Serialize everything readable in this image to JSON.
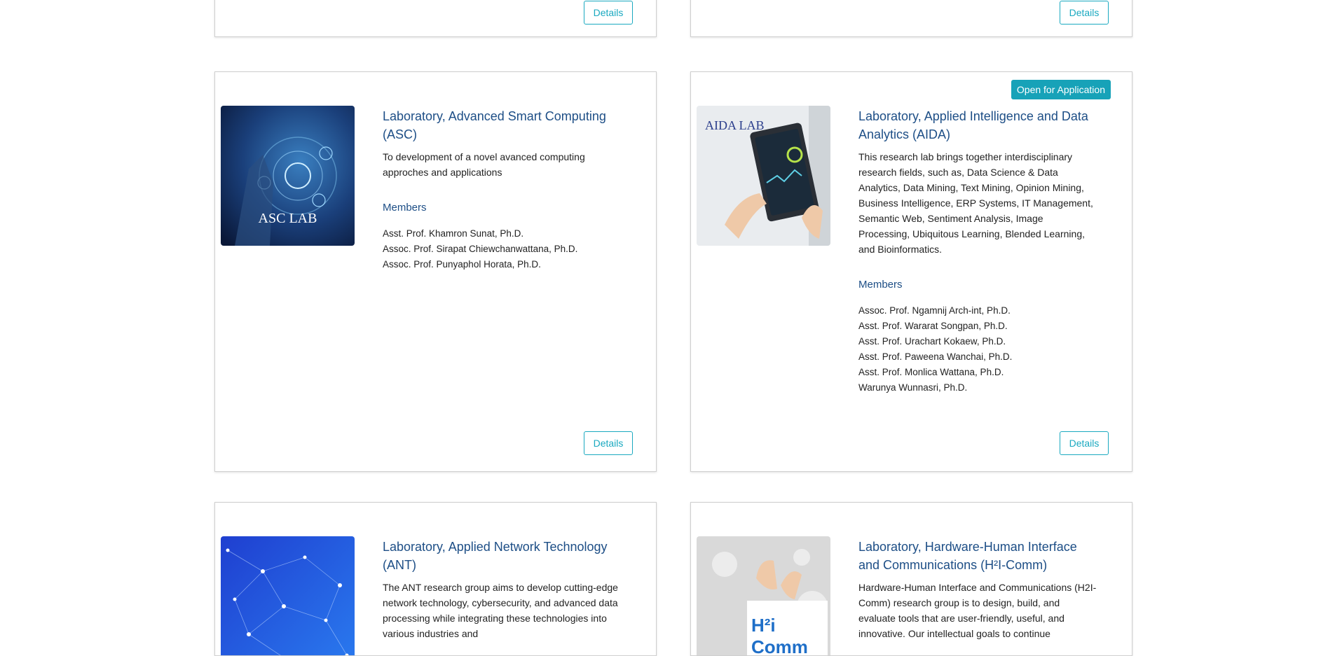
{
  "top_row": {
    "left_details_label": "Details",
    "right_details_label": "Details"
  },
  "labs": [
    {
      "title": "Laboratory, Advanced Smart Computing (ASC)",
      "image_label": "ASC LAB",
      "description": "To development of a novel avanced computing approches and applications",
      "members_heading": "Members",
      "members": [
        "Asst. Prof. Khamron Sunat, Ph.D.",
        "Assoc. Prof. Sirapat Chiewchanwattana, Ph.D.",
        "Assoc. Prof. Punyaphol Horata, Ph.D."
      ],
      "details_label": "Details"
    },
    {
      "title": "Laboratory, Applied Intelligence and Data Analytics (AIDA)",
      "badge": "Open for Application",
      "image_label": "AIDA LAB",
      "description": "This research lab brings together interdisciplinary research fields, such as, Data Science & Data Analytics, Data Mining, Text Mining, Opinion Mining, Business Intelligence, ERP Systems, IT Management, Semantic Web, Sentiment Analysis, Image Processing, Ubiquitous Learning, Blended Learning, and Bioinformatics.",
      "members_heading": "Members",
      "members": [
        "Assoc. Prof. Ngamnij Arch-int, Ph.D.",
        "Asst. Prof. Wararat Songpan, Ph.D.",
        "Asst. Prof. Urachart Kokaew, Ph.D.",
        "Asst. Prof. Paweena Wanchai, Ph.D.",
        "Asst. Prof. Monlica Wattana, Ph.D.",
        "Warunya Wunnasri, Ph.D."
      ],
      "details_label": "Details"
    },
    {
      "title": "Laboratory, Applied Network Technology (ANT)",
      "description": "The ANT research group aims to develop cutting-edge network technology, cybersecurity, and advanced data processing while integrating these technologies into various industries and"
    },
    {
      "title": "Laboratory, Hardware-Human Interface and Communications (H²I-Comm)",
      "image_label": "H²i Comm",
      "description": "Hardware-Human Interface and Communications (H2I-Comm) research group is to design, build, and evaluate tools that are user-friendly, useful, and innovative. Our intellectual goals to continue"
    }
  ],
  "colors": {
    "title_blue": "#1d4e86",
    "accent_teal": "#1aa9c0",
    "badge_bg": "#17a2b8"
  }
}
